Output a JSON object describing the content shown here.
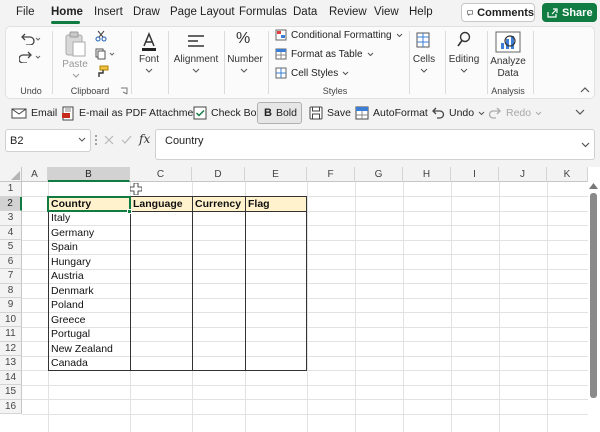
{
  "menu": {
    "tabs": [
      "File",
      "Home",
      "Insert",
      "Draw",
      "Page Layout",
      "Formulas",
      "Data",
      "Review",
      "View",
      "Help"
    ],
    "comments_label": "Comments",
    "share_label": "Share"
  },
  "ribbon": {
    "undo_group": "Undo",
    "paste_label": "Paste",
    "clipboard_group": "Clipboard",
    "font_label": "Font",
    "alignment_label": "Alignment",
    "number_label": "Number",
    "conditional_formatting": "Conditional Formatting",
    "format_as_table": "Format as Table",
    "cell_styles": "Cell Styles",
    "styles_group": "Styles",
    "cells_label": "Cells",
    "editing_label": "Editing",
    "analyze_label_1": "Analyze",
    "analyze_label_2": "Data",
    "analysis_group": "Analysis"
  },
  "toolbar": {
    "email": "Email",
    "email_pdf": "E-mail as PDF Attachment",
    "check_box": "Check Box",
    "bold": "Bold",
    "save": "Save",
    "autoformat": "AutoFormat",
    "undo": "Undo",
    "redo": "Redo"
  },
  "formula_bar": {
    "name_box": "B2",
    "fx": "fx",
    "content": "Country"
  },
  "grid": {
    "columns": [
      "A",
      "B",
      "C",
      "D",
      "E",
      "F",
      "G",
      "H",
      "I",
      "J",
      "K"
    ],
    "rows": [
      "1",
      "2",
      "3",
      "4",
      "5",
      "6",
      "7",
      "8",
      "9",
      "10",
      "11",
      "12",
      "13",
      "14",
      "15",
      "16"
    ],
    "headers": [
      "Country",
      "Language",
      "Currency",
      "Flag"
    ],
    "countries": [
      "Italy",
      "Germany",
      "Spain",
      "Hungary",
      "Austria",
      "Denmark",
      "Poland",
      "Greece",
      "Portugal",
      "New Zealand",
      "Canada"
    ],
    "selected_cell": "B2",
    "header_fill": "#fff2cc"
  },
  "colors": {
    "accent": "#107c41"
  }
}
